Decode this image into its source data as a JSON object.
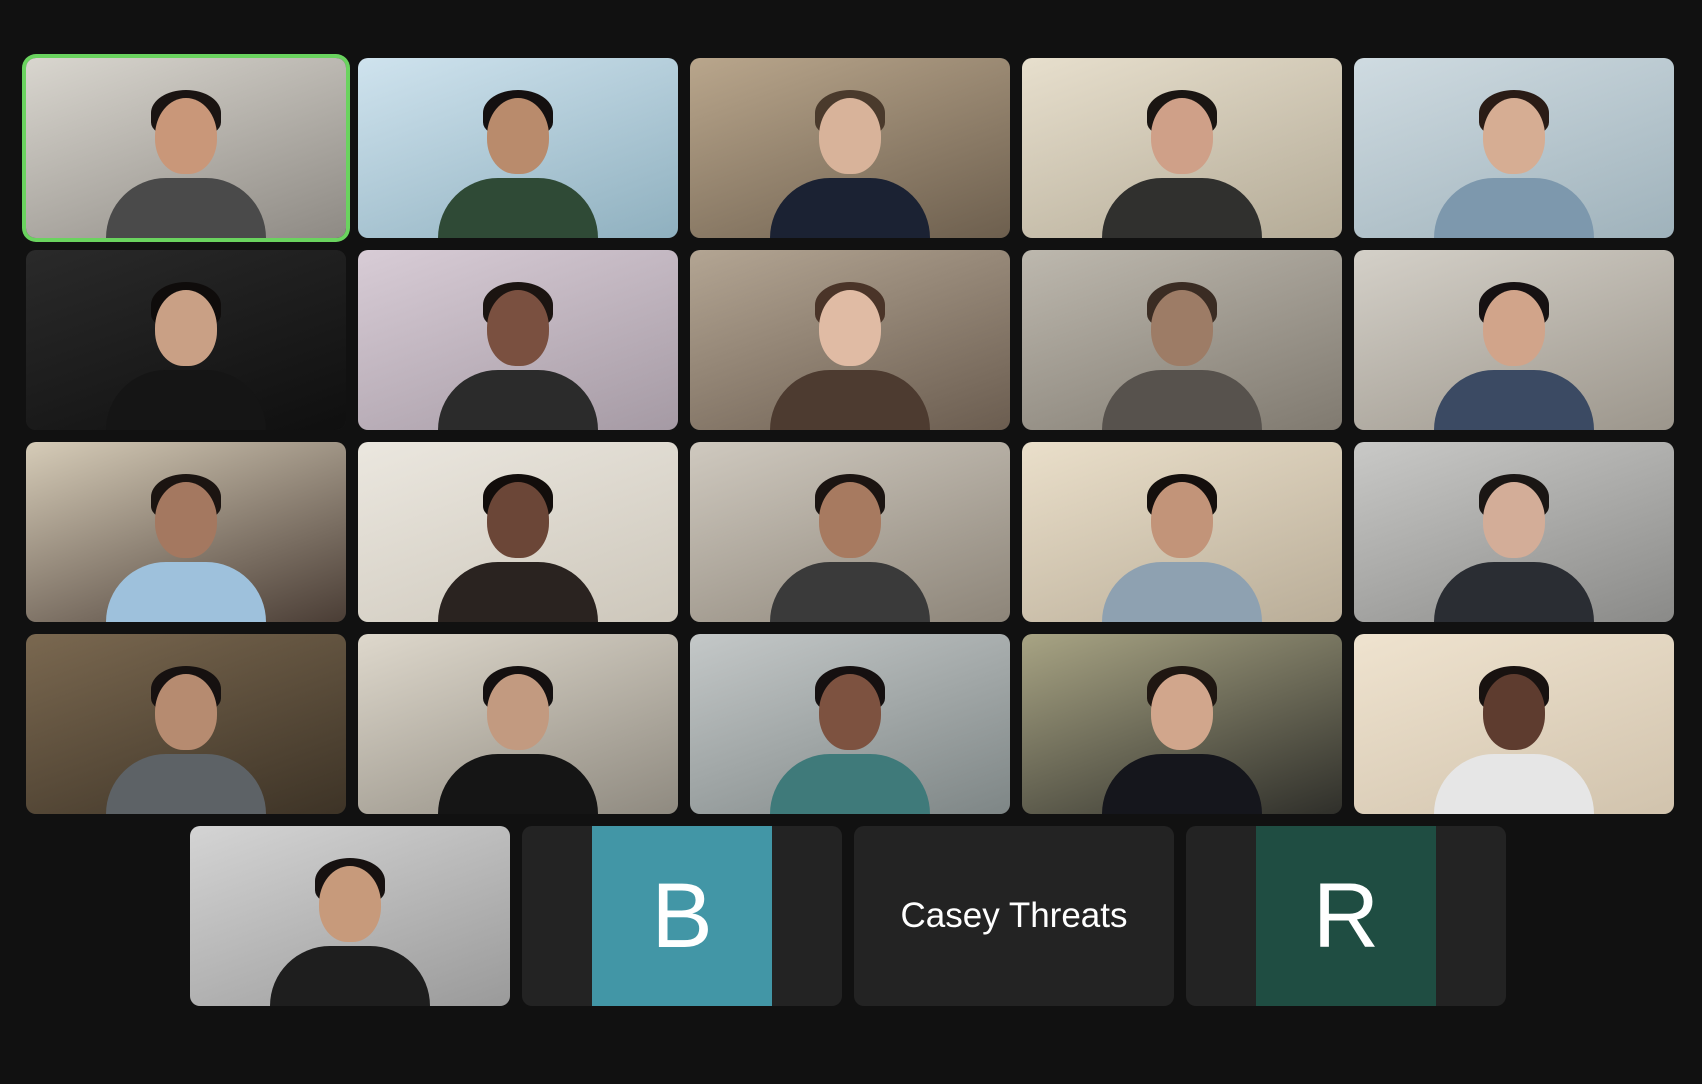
{
  "app": "Video conference - gallery view",
  "gallery": {
    "video_tiles": [
      {
        "id": "p1",
        "speaking": true,
        "bg": [
          "#d9d6cf",
          "#8e8a84"
        ],
        "skin": "#c99779",
        "hair": "#1a1412",
        "shirt": "#4a4a4a"
      },
      {
        "id": "p2",
        "speaking": false,
        "bg": [
          "#cfe3ee",
          "#8fb0bf"
        ],
        "skin": "#b98b6c",
        "hair": "#141010",
        "shirt": "#2f4a36"
      },
      {
        "id": "p3",
        "speaking": false,
        "bg": [
          "#b9a68c",
          "#6d5f4e"
        ],
        "skin": "#d8b39a",
        "hair": "#4a3a2c",
        "shirt": "#1b2233"
      },
      {
        "id": "p4",
        "speaking": false,
        "bg": [
          "#e7dfcd",
          "#b4ab97"
        ],
        "skin": "#cfa088",
        "hair": "#1a1512",
        "shirt": "#30302e"
      },
      {
        "id": "p5",
        "speaking": false,
        "bg": [
          "#cfdbe1",
          "#9fb2bb"
        ],
        "skin": "#d6ad93",
        "hair": "#2a1c16",
        "shirt": "#7d98ad"
      },
      {
        "id": "p6",
        "speaking": false,
        "bg": [
          "#2a2a2a",
          "#0f0f0f"
        ],
        "skin": "#c9a085",
        "hair": "#0f0c0b",
        "shirt": "#151515"
      },
      {
        "id": "p7",
        "speaking": false,
        "bg": [
          "#d8ccd6",
          "#a59aa4"
        ],
        "skin": "#7a5040",
        "hair": "#1b1411",
        "shirt": "#2b2b2b"
      },
      {
        "id": "p8",
        "speaking": false,
        "bg": [
          "#b3a593",
          "#6b5d50"
        ],
        "skin": "#e0bba4",
        "hair": "#4a3428",
        "shirt": "#4d3b30"
      },
      {
        "id": "p9",
        "speaking": false,
        "bg": [
          "#bdb8ae",
          "#807a70"
        ],
        "skin": "#9d7c66",
        "hair": "#3a2c23",
        "shirt": "#57524d"
      },
      {
        "id": "p10",
        "speaking": false,
        "bg": [
          "#d4d0c8",
          "#9c968c"
        ],
        "skin": "#d1a48a",
        "hair": "#161112",
        "shirt": "#3b4a63"
      },
      {
        "id": "p11",
        "speaking": false,
        "bg": [
          "#d6ccb8",
          "#4a3d35"
        ],
        "skin": "#a47860",
        "hair": "#1b1411",
        "shirt": "#9ec1dc"
      },
      {
        "id": "p12",
        "speaking": false,
        "bg": [
          "#ebe7df",
          "#cdc7bb"
        ],
        "skin": "#6b4637",
        "hair": "#120d0b",
        "shirt": "#2a2320"
      },
      {
        "id": "p13",
        "speaking": false,
        "bg": [
          "#cfc9bf",
          "#8d8579"
        ],
        "skin": "#a77a60",
        "hair": "#1b1411",
        "shirt": "#3a3a3a"
      },
      {
        "id": "p14",
        "speaking": false,
        "bg": [
          "#eadfca",
          "#b9ad98"
        ],
        "skin": "#c29479",
        "hair": "#140f0d",
        "shirt": "#8ea1b1"
      },
      {
        "id": "p15",
        "speaking": false,
        "bg": [
          "#c9c9c7",
          "#8a8a88"
        ],
        "skin": "#d3ad98",
        "hair": "#1a1614",
        "shirt": "#2a2d33"
      },
      {
        "id": "p16",
        "speaking": false,
        "bg": [
          "#7a6850",
          "#3d3326"
        ],
        "skin": "#b68b70",
        "hair": "#161110",
        "shirt": "#5d6266"
      },
      {
        "id": "p17",
        "speaking": false,
        "bg": [
          "#ded8cc",
          "#8f8a80"
        ],
        "skin": "#c29a80",
        "hair": "#141010",
        "shirt": "#151515"
      },
      {
        "id": "p18",
        "speaking": false,
        "bg": [
          "#c4c8c8",
          "#7e8686"
        ],
        "skin": "#7d5240",
        "hair": "#151010",
        "shirt": "#3f7a7a"
      },
      {
        "id": "p19",
        "speaking": false,
        "bg": [
          "#a8a484",
          "#2f2f2a"
        ],
        "skin": "#d1a68c",
        "hair": "#1f1712",
        "shirt": "#15161c"
      },
      {
        "id": "p20",
        "speaking": false,
        "bg": [
          "#efe3cf",
          "#d1c3ad"
        ],
        "skin": "#5e3c2f",
        "hair": "#181210",
        "shirt": "#e6e6e6"
      },
      {
        "id": "p21",
        "speaking": false,
        "bg": [
          "#d4d4d4",
          "#9a9a9a"
        ],
        "skin": "#c79a7b",
        "hair": "#161110",
        "shirt": "#1e1e1e"
      }
    ],
    "avatar_tiles": [
      {
        "type": "initial",
        "initial": "B",
        "color": "#4296a6"
      },
      {
        "type": "name",
        "name": "Casey Threats"
      },
      {
        "type": "initial",
        "initial": "R",
        "color": "#1f4d42"
      }
    ]
  },
  "colors": {
    "background": "#111111",
    "tile_empty": "#232323",
    "active_speaker_border": "#6ad35f"
  }
}
